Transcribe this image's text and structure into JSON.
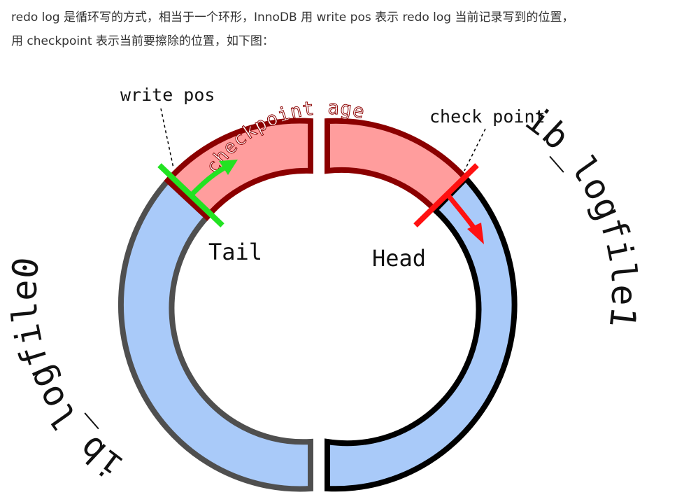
{
  "article": {
    "line1": "redo log 是循环写的方式，相当于一个环形，InnoDB 用 write pos 表示 redo log 当前记录写到的位置，",
    "line2": "用 checkpoint 表示当前要擦除的位置，如下图："
  },
  "diagram": {
    "write_pos_label": "write pos",
    "check_point_label": "check point",
    "checkpoint_age_label": "checkpoint age",
    "tail_label": "Tail",
    "head_label": "Head",
    "left_file_label": "ib_logfile0",
    "right_file_label": "ib_logfile1",
    "colors": {
      "log_fill": "#a9caf9",
      "left_outline": "#4f4f4f",
      "right_outline": "#000000",
      "age_fill": "#ff9d9d",
      "age_outline": "#8b0000",
      "write_pos_marker": "#22e322",
      "check_point_marker": "#ff1111"
    }
  }
}
